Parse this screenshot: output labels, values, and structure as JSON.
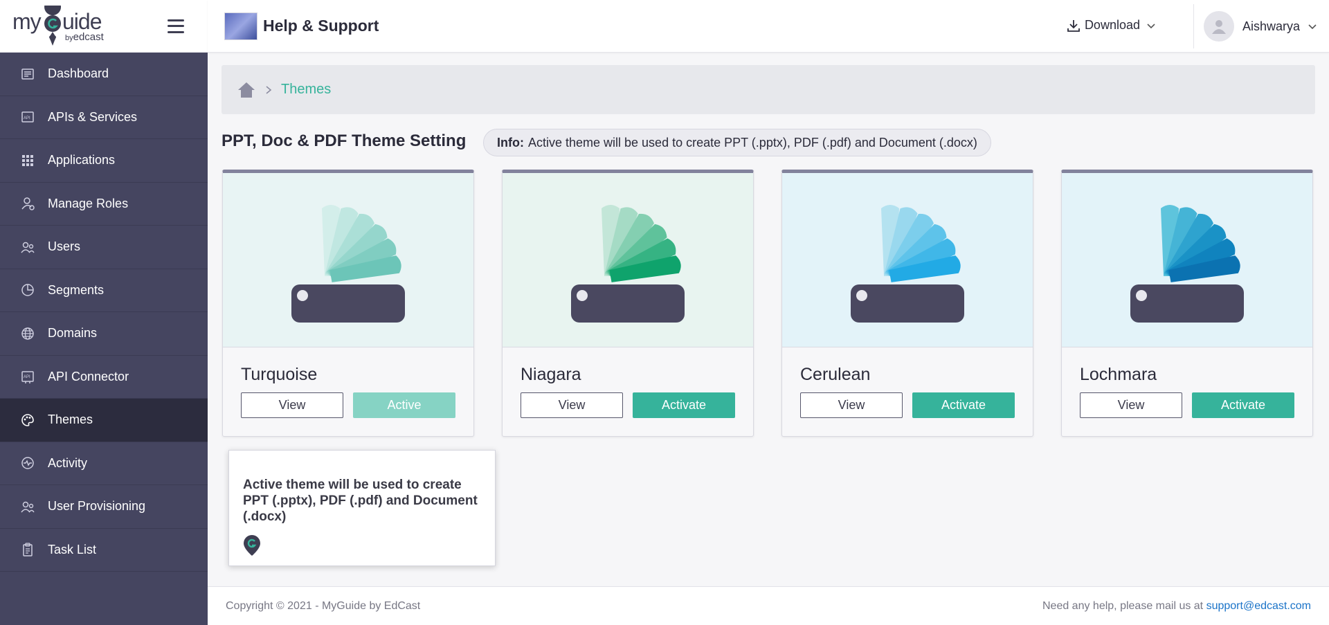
{
  "brand": {
    "logo_text": "myGuide",
    "logo_sub_prefix": "by",
    "logo_sub": "edcast"
  },
  "header": {
    "title": "Help & Support",
    "download_label": "Download",
    "user_name": "Aishwarya"
  },
  "sidebar": {
    "items": [
      {
        "label": "Dashboard",
        "icon": "dashboard-icon"
      },
      {
        "label": "APIs & Services",
        "icon": "api-icon"
      },
      {
        "label": "Applications",
        "icon": "grid-icon"
      },
      {
        "label": "Manage Roles",
        "icon": "roles-icon"
      },
      {
        "label": "Users",
        "icon": "users-icon"
      },
      {
        "label": "Segments",
        "icon": "pie-icon"
      },
      {
        "label": "Domains",
        "icon": "globe-icon"
      },
      {
        "label": "API Connector",
        "icon": "api-connector-icon"
      },
      {
        "label": "Themes",
        "icon": "palette-icon",
        "active": true
      },
      {
        "label": "Activity",
        "icon": "activity-icon"
      },
      {
        "label": "User Provisioning",
        "icon": "users-icon"
      },
      {
        "label": "Task List",
        "icon": "clipboard-icon"
      }
    ]
  },
  "breadcrumb": {
    "current": "Themes"
  },
  "page": {
    "title": "PPT, Doc & PDF Theme Setting",
    "info_label": "Info:",
    "info_text": "Active theme will be used to create PPT (.pptx), PDF (.pdf) and Document (.docx)"
  },
  "themes": [
    {
      "name": "Turquoise",
      "view_label": "View",
      "action_label": "Active",
      "is_active": true,
      "bg": "#e8f4f4",
      "colors": [
        "#d3eeea",
        "#c0e7e1",
        "#abdfd7",
        "#95d6cc",
        "#80cdc1",
        "#6cc5b8"
      ]
    },
    {
      "name": "Niagara",
      "view_label": "View",
      "action_label": "Activate",
      "is_active": false,
      "bg": "#e8f4f0",
      "colors": [
        "#c3e6d8",
        "#a5dbc5",
        "#84cfb1",
        "#5fc29b",
        "#36b383",
        "#0fa36c"
      ]
    },
    {
      "name": "Cerulean",
      "view_label": "View",
      "action_label": "Activate",
      "is_active": false,
      "bg": "#e3f3f9",
      "colors": [
        "#b4e2f0",
        "#99d8ee",
        "#7cceec",
        "#5ec3ea",
        "#40b7e8",
        "#22aae5"
      ]
    },
    {
      "name": "Lochmara",
      "view_label": "View",
      "action_label": "Activate",
      "is_active": false,
      "bg": "#e3f3f9",
      "colors": [
        "#5ec4dc",
        "#45b4d6",
        "#2ea3cf",
        "#1a92c6",
        "#1083be",
        "#0b72b1"
      ]
    }
  ],
  "tooltip": {
    "text": "Active theme will be used to create PPT (.pptx), PDF (.pdf) and Document (.docx)"
  },
  "footer": {
    "copyright": "Copyright © 2021 - MyGuide by EdCast",
    "help_text": "Need any help, please mail us at",
    "email": "support@edcast.com"
  },
  "colors": {
    "accent": "#36b39b",
    "sidebar_bg": "#454560",
    "sidebar_active": "#2c2c3e"
  }
}
